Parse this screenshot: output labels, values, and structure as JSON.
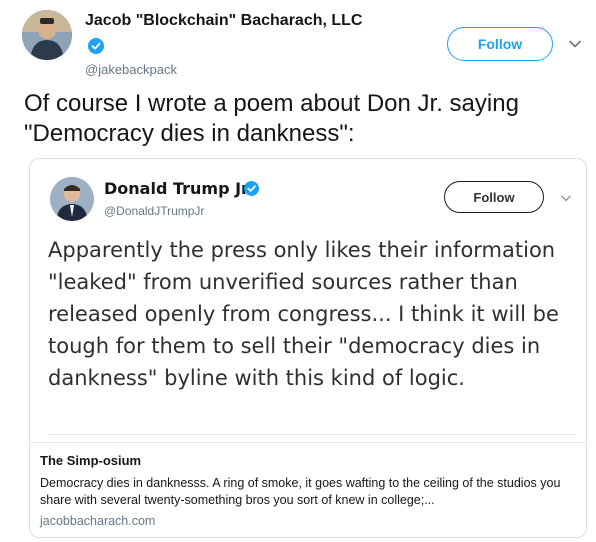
{
  "tweet": {
    "author": {
      "display_name": "Jacob \"Blockchain\" Bacharach, LLC",
      "handle": "@jakebackpack",
      "verified": true,
      "avatar_icon": "user-avatar"
    },
    "follow_label": "Follow",
    "text": "Of course I wrote a poem about Don Jr. saying \"Democracy dies in dankness\":",
    "quoted_tweet": {
      "author": {
        "display_name": "Donald Trump Jr.",
        "handle": "@DonaldJTrumpJr",
        "verified": true,
        "avatar_icon": "user-avatar"
      },
      "follow_label": "Follow",
      "text": "Apparently the press only likes their information \"leaked\" from unverified sources rather than released openly from congress... I think it will be tough for them to sell their \"democracy dies in dankness\" byline with this kind of logic."
    },
    "link_card": {
      "title": "The Simp-osium",
      "description": "Democracy dies in danknesss. A ring of smoke, it goes wafting to the ceiling of the studios you share with several twenty-something bros you sort of knew in college;...",
      "domain": "jacobbacharach.com"
    }
  },
  "colors": {
    "accent": "#1da1f2",
    "text": "#14171a",
    "muted": "#657786",
    "border": "#e1e8ed"
  }
}
